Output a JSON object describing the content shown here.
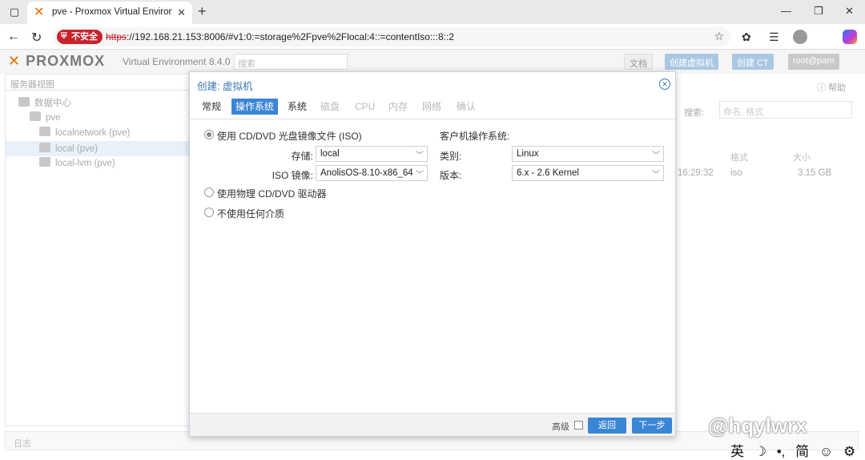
{
  "browser": {
    "tab_title": "pve - Proxmox Virtual Environment",
    "insecure_label": "不安全",
    "url_proto": "https",
    "url_rest": "://192.168.21.153:8006/#v1:0:=storage%2Fpve%2Flocal:4::=contentIso:::8::2"
  },
  "pve": {
    "logo": "PROXMOX",
    "version": "Virtual Environment 8.4.0",
    "search_placeholder": "搜索",
    "header_buttons": [
      "文档",
      "创建虚拟机",
      "创建 CT",
      "root@pam"
    ],
    "tree_view_label": "服务器视图",
    "tree": [
      "数据中心",
      "pve",
      "localnetwork (pve)",
      "local (pve)",
      "local-lvm (pve)"
    ],
    "help": "帮助",
    "search_label": "搜索:",
    "search_input_placeholder": "命名, 格式",
    "columns": [
      "格式",
      "大小"
    ],
    "row": {
      "date": "16:29:32",
      "format": "iso",
      "size": "3.15 GB"
    },
    "log_label": "日志"
  },
  "dialog": {
    "title": "创建: 虚拟机",
    "tabs": [
      {
        "label": "常规",
        "state": "normal"
      },
      {
        "label": "操作系统",
        "state": "active"
      },
      {
        "label": "系统",
        "state": "normal"
      },
      {
        "label": "磁盘",
        "state": "disabled"
      },
      {
        "label": "CPU",
        "state": "disabled"
      },
      {
        "label": "内存",
        "state": "disabled"
      },
      {
        "label": "网络",
        "state": "disabled"
      },
      {
        "label": "确认",
        "state": "disabled"
      }
    ],
    "media": {
      "use_iso": "使用 CD/DVD 光盘镜像文件 (ISO)",
      "storage_label": "存储:",
      "storage_value": "local",
      "iso_label": "ISO 镜像:",
      "iso_value": "AnolisOS-8.10-x86_64",
      "use_physical": "使用物理 CD/DVD 驱动器",
      "no_media": "不使用任何介质"
    },
    "guest": {
      "heading": "客户机操作系统:",
      "type_label": "类别:",
      "type_value": "Linux",
      "version_label": "版本:",
      "version_value": "6.x - 2.6 Kernel"
    },
    "footer": {
      "advanced_label": "高级",
      "back": "返回",
      "next": "下一步"
    }
  },
  "overlay": {
    "watermark": "@hqylwrx",
    "ime": [
      "英",
      "☽",
      "•,",
      "简",
      "☺",
      "⚙"
    ]
  }
}
